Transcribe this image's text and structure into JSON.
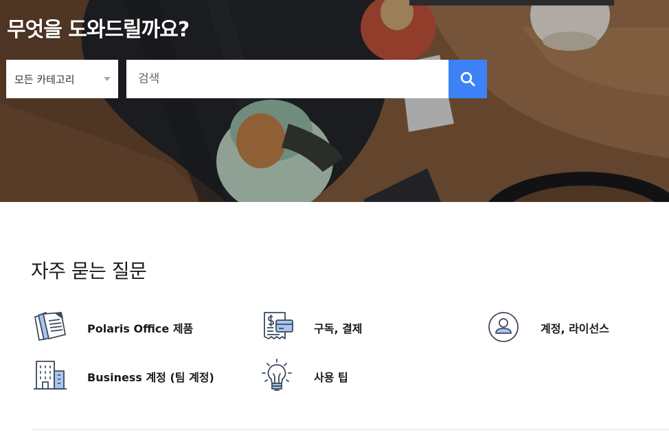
{
  "hero": {
    "title": "무엇을 도와드릴까요?",
    "category_select": {
      "selected": "모든 카테고리"
    },
    "search": {
      "placeholder": "검색"
    },
    "search_button_icon": "search-icon"
  },
  "faq": {
    "title": "자주 묻는 질문",
    "items": [
      {
        "label": "Polaris Office 제품",
        "icon": "documents-icon"
      },
      {
        "label": "구독, 결제",
        "icon": "receipt-card-icon"
      },
      {
        "label": "계정, 라이선스",
        "icon": "user-circle-icon"
      },
      {
        "label": "Business 계정 (팀 계정)",
        "icon": "office-building-icon"
      },
      {
        "label": "사용 팁",
        "icon": "lightbulb-icon"
      }
    ]
  },
  "colors": {
    "accent": "#3c82f6",
    "icon_stroke": "#3b4a5c",
    "icon_fill": "#a9c4ee"
  }
}
